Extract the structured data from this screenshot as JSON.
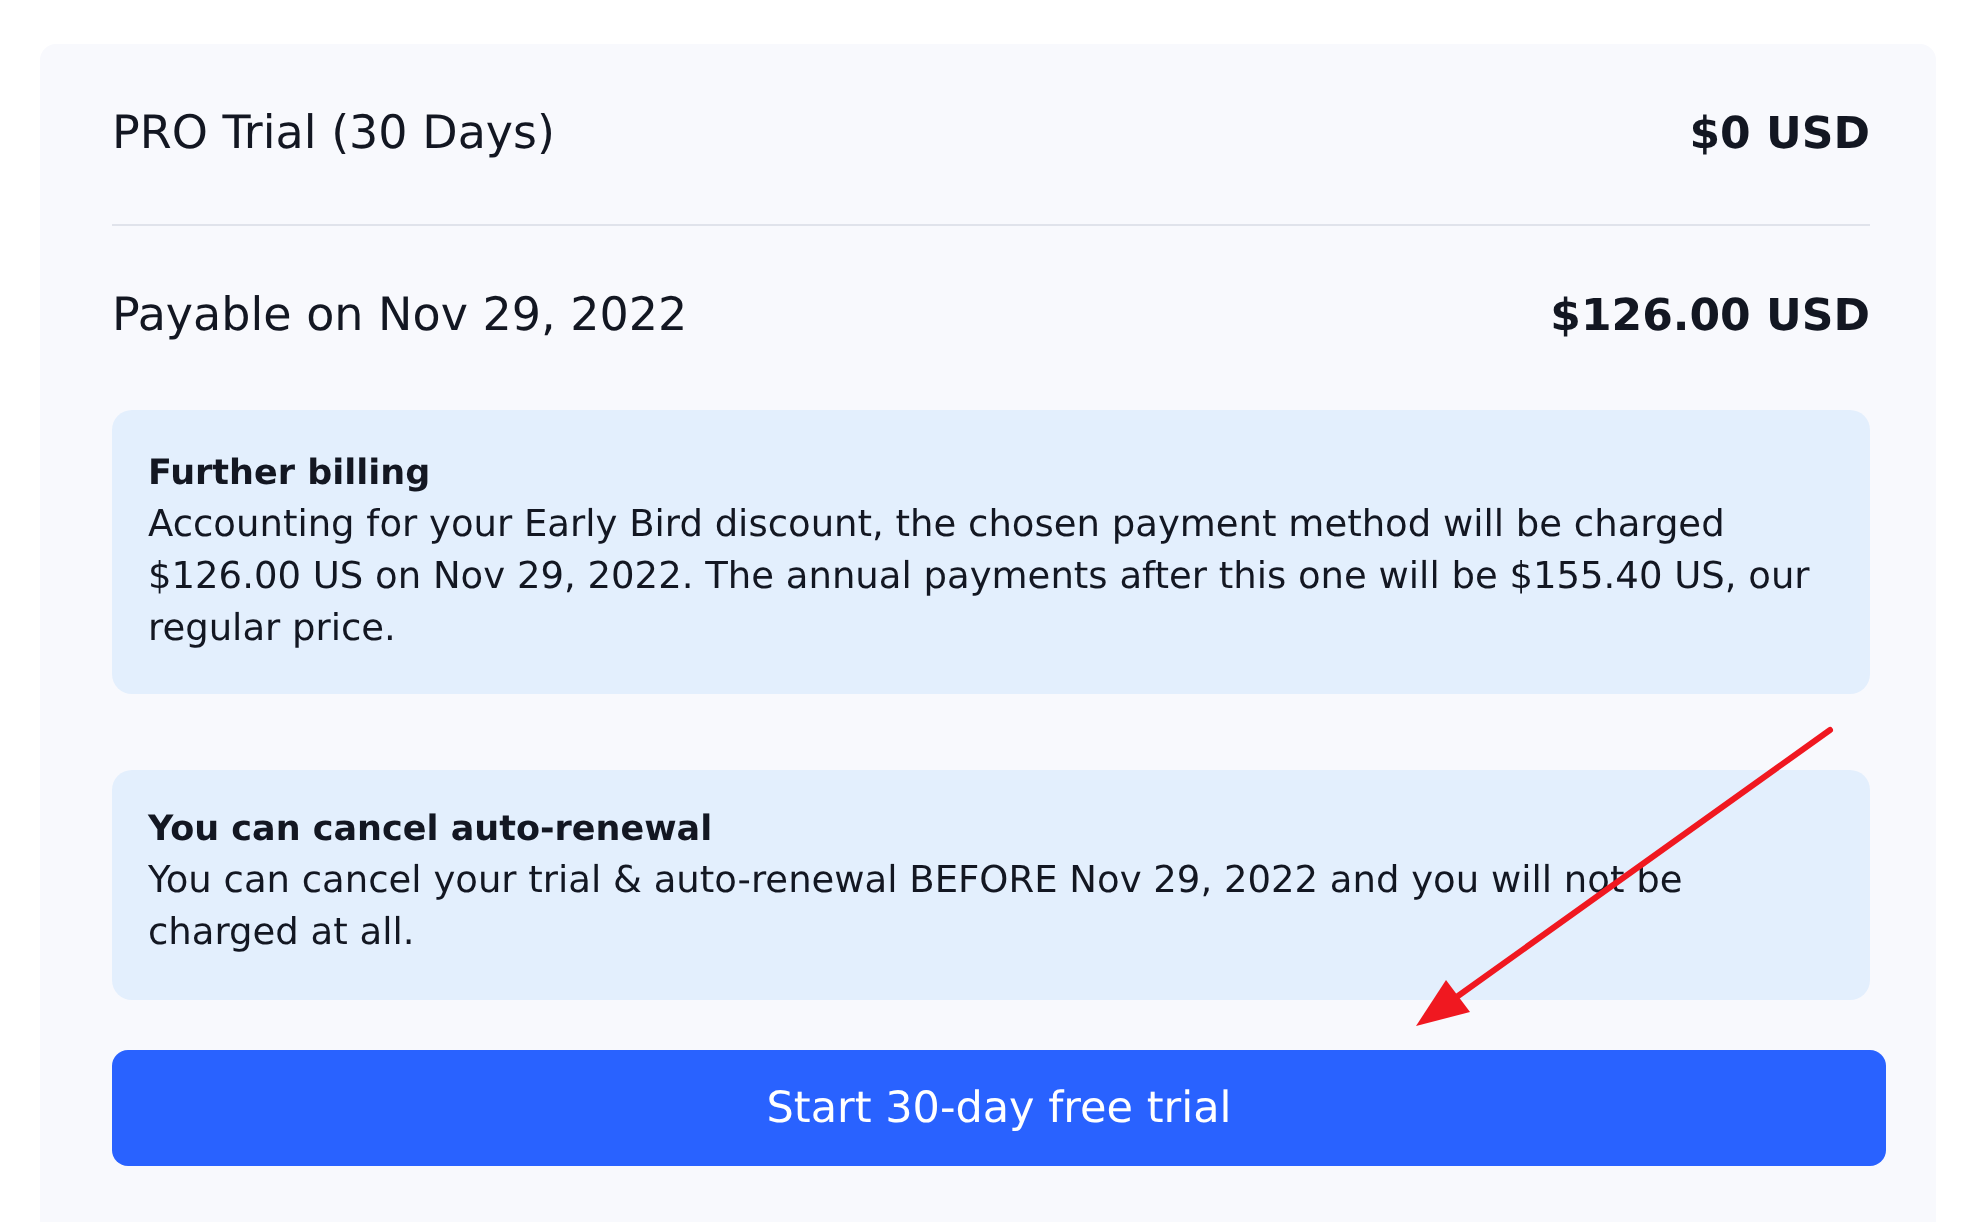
{
  "line_items": [
    {
      "label": "PRO Trial (30 Days)",
      "amount": "$0 USD"
    },
    {
      "label": "Payable on Nov 29, 2022",
      "amount": "$126.00 USD"
    }
  ],
  "notices": [
    {
      "title": "Further billing",
      "body": "Accounting for your Early Bird discount, the chosen payment method will be charged $126.00 US on Nov 29, 2022. The annual payments after this one will be $155.40 US, our regular price."
    },
    {
      "title": "You can cancel auto-renewal",
      "body": "You can cancel your trial & auto-renewal BEFORE Nov 29, 2022 and you will not be charged at all."
    }
  ],
  "primary_button": {
    "label": "Start 30-day free trial"
  }
}
